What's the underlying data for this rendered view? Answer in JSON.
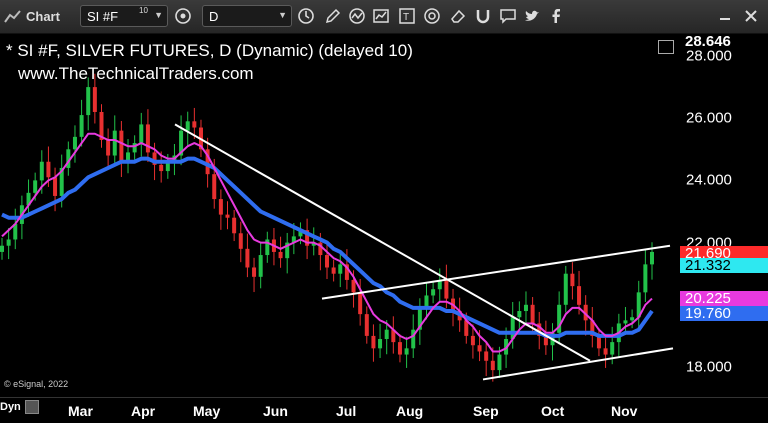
{
  "toolbar": {
    "chart_label": "Chart",
    "symbol": "SI #F",
    "symbol_link_number": "10",
    "interval": "D",
    "tools": [
      "clock-icon",
      "pen-icon",
      "indicator-icon",
      "study-icon",
      "text-tool-icon",
      "target-icon",
      "eraser-icon",
      "magnet-icon",
      "comment-icon",
      "twitter-icon",
      "facebook-icon"
    ]
  },
  "chart": {
    "title": "* SI #F, SILVER FUTURES, D (Dynamic) (delayed 10)",
    "subtitle": "www.TheTechnicalTraders.com",
    "copyright": "© eSignal, 2022",
    "dyn_label": "Dyn"
  },
  "price_axis": {
    "ticks": [
      "28.000",
      "26.000",
      "24.000",
      "22.000",
      "18.000"
    ],
    "tags": {
      "last": "28.646",
      "red": "21.690",
      "cyan": "21.332",
      "magenta": "20.225",
      "blue": "19.760"
    }
  },
  "time_axis": {
    "months": [
      "Mar",
      "Apr",
      "May",
      "Jun",
      "Jul",
      "Aug",
      "Sep",
      "Oct",
      "Nov"
    ]
  },
  "colors": {
    "up": "#22c24a",
    "down": "#e83030",
    "ma_fast": "#e83adf",
    "ma_slow": "#2f6df0",
    "trendline": "#ffffff",
    "tag_red": "#ff2a2a",
    "tag_cyan": "#2ee8f0",
    "tag_magenta": "#e83adf",
    "tag_blue": "#2f6df0"
  },
  "chart_data": {
    "type": "candlestick",
    "y_range": [
      17.6,
      28.8
    ],
    "close_series": [
      21.9,
      22.1,
      22.6,
      23.2,
      23.6,
      24.0,
      24.6,
      24.1,
      23.5,
      24.4,
      25.0,
      25.4,
      26.1,
      27.0,
      26.2,
      25.3,
      24.8,
      25.6,
      24.6,
      24.9,
      25.2,
      25.8,
      24.9,
      24.5,
      24.3,
      24.6,
      24.8,
      25.6,
      25.9,
      25.7,
      25.0,
      24.2,
      23.4,
      22.9,
      22.8,
      22.3,
      21.8,
      21.2,
      20.9,
      21.6,
      22.1,
      21.7,
      21.5,
      22.0,
      22.2,
      22.4,
      21.9,
      22.0,
      21.6,
      21.2,
      21.0,
      21.3,
      20.8,
      20.4,
      19.7,
      19.0,
      18.6,
      18.9,
      19.2,
      18.8,
      18.4,
      18.6,
      19.2,
      19.9,
      20.3,
      20.5,
      20.8,
      20.2,
      19.8,
      19.5,
      19.0,
      18.7,
      18.5,
      18.2,
      17.9,
      18.4,
      18.9,
      19.6,
      19.8,
      20.0,
      19.4,
      19.0,
      18.7,
      19.1,
      20.0,
      21.0,
      20.6,
      20.0,
      19.5,
      19.0,
      18.6,
      18.4,
      18.8,
      19.4,
      19.5,
      19.6,
      20.4,
      21.3,
      21.7
    ],
    "ma_fast": [
      22.2,
      22.4,
      22.6,
      22.9,
      23.2,
      23.5,
      23.8,
      24.0,
      24.1,
      24.3,
      24.6,
      24.9,
      25.2,
      25.5,
      25.5,
      25.4,
      25.3,
      25.3,
      25.2,
      25.1,
      25.1,
      25.2,
      25.1,
      25.0,
      24.8,
      24.7,
      24.7,
      24.9,
      25.1,
      25.2,
      25.1,
      24.8,
      24.4,
      24.0,
      23.6,
      23.2,
      22.8,
      22.4,
      22.1,
      22.0,
      22.0,
      21.9,
      21.8,
      21.9,
      22.0,
      22.1,
      22.0,
      22.0,
      21.9,
      21.7,
      21.5,
      21.4,
      21.2,
      20.9,
      20.5,
      20.1,
      19.7,
      19.5,
      19.4,
      19.2,
      19.0,
      18.9,
      19.0,
      19.3,
      19.6,
      19.9,
      20.1,
      20.1,
      20.0,
      19.8,
      19.5,
      19.3,
      19.0,
      18.8,
      18.5,
      18.5,
      18.6,
      18.9,
      19.2,
      19.4,
      19.4,
      19.3,
      19.1,
      19.1,
      19.3,
      19.7,
      19.9,
      19.9,
      19.7,
      19.5,
      19.2,
      19.0,
      19.0,
      19.1,
      19.3,
      19.4,
      19.6,
      20.0,
      20.2
    ],
    "ma_slow": [
      22.9,
      22.8,
      22.8,
      22.8,
      22.9,
      23.0,
      23.1,
      23.2,
      23.3,
      23.4,
      23.6,
      23.7,
      23.9,
      24.1,
      24.2,
      24.3,
      24.4,
      24.5,
      24.6,
      24.6,
      24.6,
      24.7,
      24.7,
      24.6,
      24.6,
      24.6,
      24.6,
      24.6,
      24.7,
      24.7,
      24.6,
      24.5,
      24.4,
      24.2,
      24.0,
      23.8,
      23.6,
      23.4,
      23.2,
      23.0,
      22.9,
      22.8,
      22.7,
      22.6,
      22.5,
      22.4,
      22.3,
      22.2,
      22.1,
      22.0,
      21.8,
      21.7,
      21.5,
      21.3,
      21.1,
      20.9,
      20.7,
      20.6,
      20.4,
      20.3,
      20.1,
      20.0,
      19.9,
      19.9,
      19.9,
      19.9,
      19.9,
      19.8,
      19.8,
      19.7,
      19.6,
      19.5,
      19.4,
      19.3,
      19.2,
      19.1,
      19.1,
      19.1,
      19.1,
      19.1,
      19.1,
      19.1,
      19.0,
      19.0,
      19.0,
      19.1,
      19.1,
      19.1,
      19.1,
      19.1,
      19.0,
      19.0,
      19.0,
      19.0,
      19.1,
      19.1,
      19.2,
      19.5,
      19.8
    ]
  }
}
